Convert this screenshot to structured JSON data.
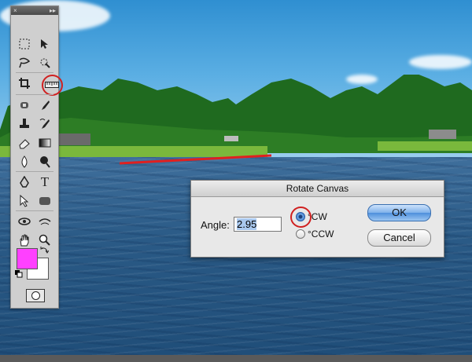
{
  "tools_panel": {
    "close_glyph": "×",
    "collapse_glyph": "▸▸",
    "icons": [
      "marquee-icon",
      "move-icon",
      "lasso-icon",
      "quick-selection-icon",
      "crop-icon",
      "ruler-icon",
      "spot-healing-icon",
      "brush-icon",
      "clone-stamp-icon",
      "history-brush-icon",
      "eraser-icon",
      "gradient-icon",
      "blur-icon",
      "dodge-icon",
      "pen-icon",
      "type-icon",
      "path-selection-icon",
      "shape-icon",
      "3d-rotate-icon",
      "3d-orbit-icon",
      "hand-icon",
      "zoom-icon"
    ],
    "type_glyph": "T",
    "foreground_color": "#ff40ff",
    "background_color": "#ffffff"
  },
  "dialog": {
    "title": "Rotate Canvas",
    "angle_label": "Angle:",
    "angle_value": "2.95",
    "cw_label": "°CW",
    "ccw_label": "°CCW",
    "ok_label": "OK",
    "cancel_label": "Cancel",
    "selected_option": "CW"
  },
  "colors": {
    "highlight": "#d02020",
    "measure_line": "#e02020"
  }
}
